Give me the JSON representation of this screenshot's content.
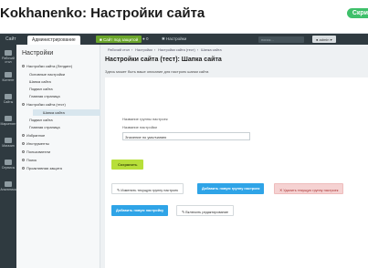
{
  "slide": {
    "title": "Kokhanenko: Настройки сайта",
    "badge": "Скри"
  },
  "topbar": {
    "tab_site": "Сайт",
    "tab_admin": "Администрирование",
    "site_button": "Сайт под защитой",
    "item_1": "0",
    "item_2": "Настройки",
    "search_placeholder": "поиск...",
    "user_label": "admin"
  },
  "iconbar": {
    "items": [
      {
        "label": "Рабочий стол",
        "icon": "desktop-icon"
      },
      {
        "label": "Контент",
        "icon": "content-icon"
      },
      {
        "label": "Сайты",
        "icon": "sites-icon"
      },
      {
        "label": "Маркетинг",
        "icon": "marketing-icon"
      },
      {
        "label": "Магазин",
        "icon": "shop-icon"
      },
      {
        "label": "Сервисы",
        "icon": "services-icon"
      },
      {
        "label": "Аналитика",
        "icon": "analytics-icon"
      }
    ]
  },
  "tree": {
    "title": "Настройки",
    "items": [
      "Настройки сайта (Лендинг)",
      "Основные настройки",
      "Шапка сайта",
      "Подвал сайта",
      "Главная страница",
      "Настройки сайта (тест)",
      "Шапка сайта",
      "Подвал сайта",
      "Главная страница",
      "Избранное",
      "Инструменты",
      "Пользователи",
      "Поиск",
      "Проактивная защита"
    ]
  },
  "main": {
    "breadcrumbs": [
      "Рабочий стол",
      "Настройки",
      "Настройки сайта (тест)",
      "Шапка сайта"
    ],
    "page_title": "Настройки сайта (тест): Шапка сайта",
    "hint": "Здесь может быть ваше описание для настроек шапки сайта",
    "group_label": "Название группы настроек",
    "field_label": "Название настройки",
    "field_value": "Значение по умолчанию",
    "save_button": "Сохранить",
    "btn_change_group": "Изменить текущую группу настроек",
    "btn_add_group": "Добавить новую группу настроек",
    "btn_delete_group": "Удалить текущую группу настроек",
    "btn_add_setting": "Добавить новую настройку",
    "btn_edit_mode": "Включить редактирование"
  },
  "colors": {
    "admin_bar": "#2f3a40",
    "save_green": "#b7df3a",
    "primary_blue": "#2fa4e7",
    "danger_pink": "#f5d2d2",
    "badge_green": "#3ec06a"
  }
}
